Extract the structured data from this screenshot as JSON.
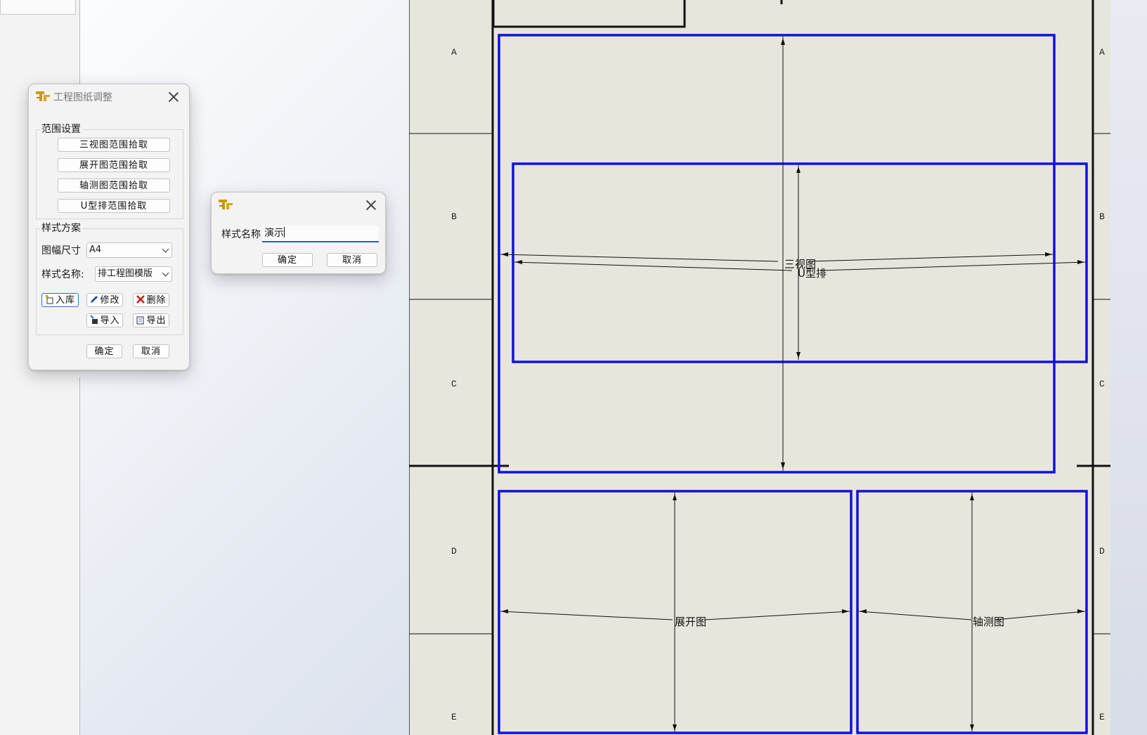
{
  "main_dialog": {
    "title": "工程图纸调整",
    "range_group": {
      "label": "范围设置",
      "buttons": [
        "三视图范围拾取",
        "展开图范围拾取",
        "轴测图范围拾取",
        "U型排范围拾取"
      ]
    },
    "style_group": {
      "label": "样式方案",
      "sheet_size_label": "图幅尺寸",
      "sheet_size_value": "A4",
      "style_name_label": "样式名称:",
      "style_name_value": "排工程图模版",
      "add_label": "入库",
      "modify_label": "修改",
      "delete_label": "删除",
      "import_label": "导入",
      "export_label": "导出"
    },
    "ok_label": "确定",
    "cancel_label": "取消"
  },
  "name_dialog": {
    "field_label": "样式名称",
    "field_value": "演示",
    "ok_label": "确定",
    "cancel_label": "取消"
  },
  "drawing": {
    "row_labels": [
      "A",
      "B",
      "C",
      "D",
      "E"
    ],
    "view_labels": {
      "three_view": "三视图",
      "u_row": "U型排",
      "unfold": "展开图",
      "iso": "轴测图"
    },
    "region_color": "#1010e0"
  },
  "colors": {
    "sheet_background": "#e7e6dc",
    "accent": "#1f63c6"
  }
}
